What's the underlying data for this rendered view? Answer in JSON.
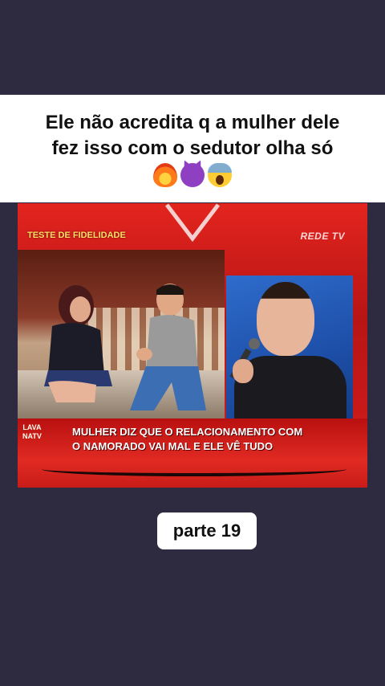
{
  "caption": {
    "line1": "Ele não acredita q a mulher dele",
    "line2": "fez isso com o sedutor olha só",
    "emojis": [
      "fire-emoji",
      "devil-emoji",
      "scream-emoji"
    ]
  },
  "video": {
    "badge": "TESTE DE FIDELIDADE",
    "channel_logo": "REDE TV",
    "lower_third": {
      "logo_line1": "LAVA",
      "logo_line2": "NATV",
      "line1": "MULHER DIZ QUE O RELACIONAMENTO COM",
      "line2": "O NAMORADO VAI MAL E ELE VÊ TUDO"
    }
  },
  "part_label": "parte 19",
  "colors": {
    "background": "#2e2a40",
    "caption_bg": "#ffffff",
    "studio_red": "#d81d1d"
  }
}
